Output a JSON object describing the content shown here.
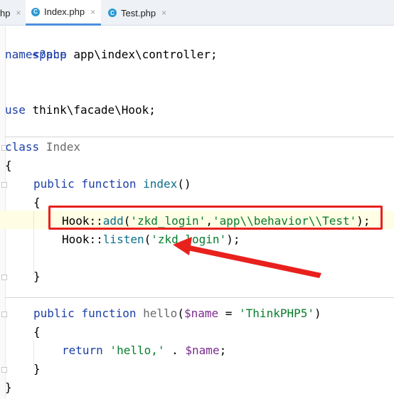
{
  "tabs": [
    {
      "label": "hp",
      "close": "×"
    },
    {
      "label": "Index.php",
      "icon": "C",
      "close": "×"
    },
    {
      "label": "Test.php",
      "icon": "C",
      "close": "×"
    }
  ],
  "code": {
    "line1": "<?php",
    "line2_kw": "namespace",
    "line2_rest": " app\\index\\controller;",
    "line4_kw": "use",
    "line4_rest": " think\\facade\\Hook;",
    "line6_kw": "class",
    "line6_cls": " Index",
    "open_brace": "{",
    "m1_public": "public",
    "m1_function": "function",
    "m1_name": "index",
    "m1_parens": "()",
    "m1_open": "{",
    "hook_add_obj": "Hook",
    "hook_add_sep": "::",
    "hook_add_fn": "add",
    "hook_add_p1": "(",
    "hook_add_arg1": "'zkd_login'",
    "hook_add_comma": ",",
    "hook_add_arg2": "'app\\\\behavior\\\\Test'",
    "hook_add_end": ");",
    "hook_listen_obj": "Hook",
    "hook_listen_sep": "::",
    "hook_listen_fn": "listen",
    "hook_listen_p1": "(",
    "hook_listen_arg": "'zkd_login'",
    "hook_listen_end": ");",
    "m1_close": "}",
    "m2_public": "public",
    "m2_function": "function",
    "m2_name": "hello",
    "m2_p1": "(",
    "m2_var": "$name",
    "m2_eq": " = ",
    "m2_default": "'ThinkPHP5'",
    "m2_p2": ")",
    "m2_open": "{",
    "ret_kw": "return",
    "ret_str": " 'hello,'",
    "ret_dot": " . ",
    "ret_var": "$name",
    "ret_semi": ";",
    "m2_close": "}",
    "close_brace": "}"
  },
  "colors": {
    "highlight_box": "#e8211d",
    "arrow": "#e8211d",
    "keyword": "#1c3fa8",
    "string": "#087d2d"
  }
}
